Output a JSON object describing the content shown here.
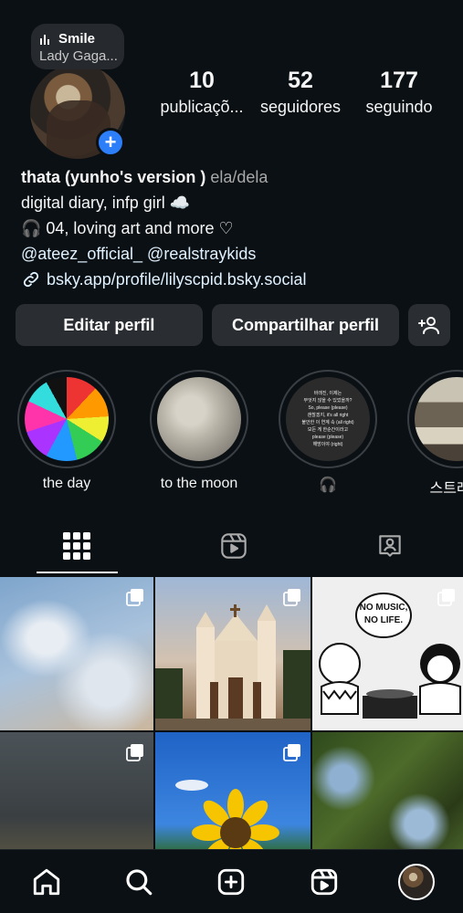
{
  "music": {
    "title": "Smile",
    "artist": "Lady Gaga..."
  },
  "stats": [
    {
      "value": "10",
      "label": "publicaçõ..."
    },
    {
      "value": "52",
      "label": "seguidores"
    },
    {
      "value": "177",
      "label": "seguindo"
    }
  ],
  "bio": {
    "name": "thata (yunho's version )",
    "pronouns": "ela/dela",
    "line1": "digital diary, infp girl ☁️",
    "line2": "🎧 04, loving art and more ♡",
    "mention1": "@ateez_official_",
    "mention2": "@realstraykids",
    "link": "bsky.app/profile/lilyscpid.bsky.social"
  },
  "actions": {
    "edit": "Editar perfil",
    "share": "Compartilhar perfil"
  },
  "highlights": [
    {
      "label": "the day"
    },
    {
      "label": "to the moon"
    },
    {
      "label": "🎧"
    },
    {
      "label": "스트레이"
    }
  ],
  "highlight_text": {
    "line1": "바래진, 이제는",
    "line2": "무엇지 않을 수 있었을까?",
    "line3": "So, please (please)",
    "line4": "괜찮겠지, it's all right",
    "line5": "불안한 이 연계 속 (all right)",
    "line6": "모든 게 한순간이라고",
    "line7": "please (please)",
    "line8": "해방이야 (right)"
  },
  "grid_text": {
    "sign": "NO MUSIC, NO LIFE."
  },
  "colors": {
    "background": "#0b1014",
    "accent": "#2d7ff9",
    "button": "#2a2e33"
  },
  "icons": [
    "grid-icon",
    "reels-icon",
    "tagged-icon",
    "home-icon",
    "search-icon",
    "create-icon",
    "reels-nav-icon",
    "add-person-icon",
    "link-icon"
  ]
}
